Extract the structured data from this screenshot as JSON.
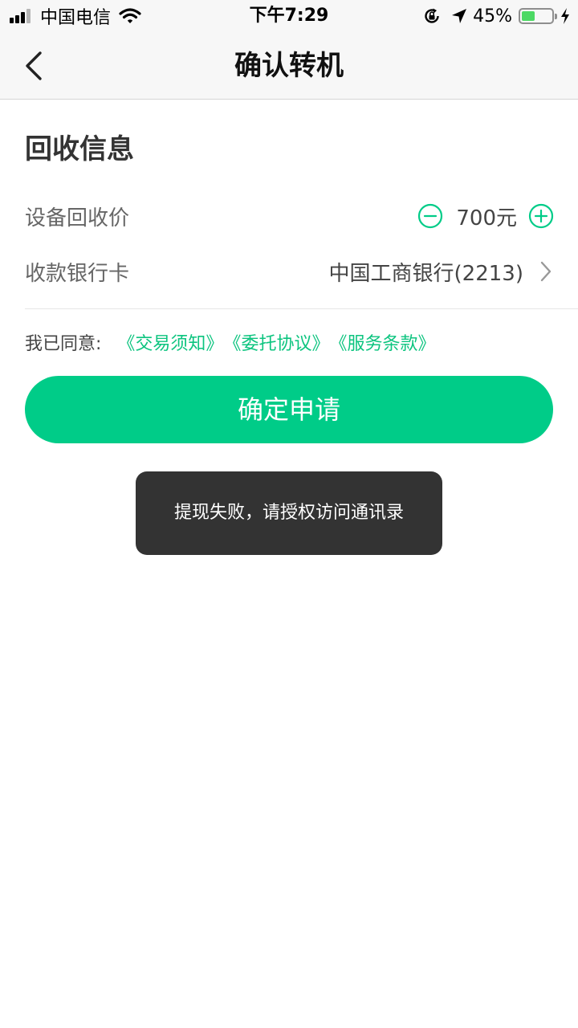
{
  "status_bar": {
    "carrier": "中国电信",
    "time": "下午7:29",
    "battery_percent_text": "45%",
    "battery_level": 0.45
  },
  "nav": {
    "title": "确认转机"
  },
  "section": {
    "title": "回收信息"
  },
  "price_row": {
    "label": "设备回收价",
    "value": "700元"
  },
  "bank_row": {
    "label": "收款银行卡",
    "value": "中国工商银行(2213)"
  },
  "agreement": {
    "label": "我已同意:",
    "links": [
      "《交易须知》",
      "《委托协议》",
      "《服务条款》"
    ]
  },
  "confirm_button": {
    "label": "确定申请"
  },
  "toast": {
    "message": "提现失败，请授权访问通讯录"
  },
  "colors": {
    "accent": "#00cc88",
    "link": "#0cc47f",
    "toast_bg": "#333333"
  }
}
